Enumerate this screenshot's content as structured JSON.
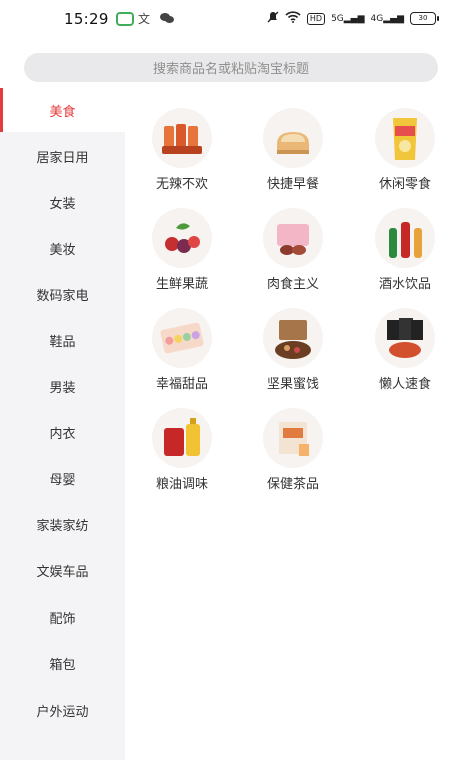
{
  "status_bar": {
    "time": "15:29",
    "app_icons": [
      "message-app-icon",
      "translate-icon",
      "wechat-icon"
    ],
    "right": {
      "hd": "HD",
      "net1": "5G",
      "net2": "4G",
      "battery": "30"
    }
  },
  "search": {
    "placeholder": "搜索商品名或粘贴淘宝标题"
  },
  "sidebar": {
    "active_color": "#e23b3b",
    "items": [
      {
        "label": "美食",
        "active": true
      },
      {
        "label": "居家日用",
        "active": false
      },
      {
        "label": "女装",
        "active": false
      },
      {
        "label": "美妆",
        "active": false
      },
      {
        "label": "数码家电",
        "active": false
      },
      {
        "label": "鞋品",
        "active": false
      },
      {
        "label": "男装",
        "active": false
      },
      {
        "label": "内衣",
        "active": false
      },
      {
        "label": "母婴",
        "active": false
      },
      {
        "label": "家装家纺",
        "active": false
      },
      {
        "label": "文娱车品",
        "active": false
      },
      {
        "label": "配饰",
        "active": false
      },
      {
        "label": "箱包",
        "active": false
      },
      {
        "label": "户外运动",
        "active": false
      }
    ]
  },
  "categories": [
    {
      "label": "无辣不欢",
      "icon": "spicy-snacks-icon"
    },
    {
      "label": "快捷早餐",
      "icon": "bread-icon"
    },
    {
      "label": "休闲零食",
      "icon": "chips-bag-icon"
    },
    {
      "label": "生鲜果蔬",
      "icon": "fruits-icon"
    },
    {
      "label": "肉食主义",
      "icon": "meat-box-icon"
    },
    {
      "label": "酒水饮品",
      "icon": "drinks-bottles-icon"
    },
    {
      "label": "幸福甜品",
      "icon": "macaron-box-icon"
    },
    {
      "label": "坚果蜜饯",
      "icon": "nuts-box-icon"
    },
    {
      "label": "懒人速食",
      "icon": "instant-noodles-icon"
    },
    {
      "label": "粮油调味",
      "icon": "rice-oil-icon"
    },
    {
      "label": "保健茶品",
      "icon": "tea-box-icon"
    }
  ]
}
